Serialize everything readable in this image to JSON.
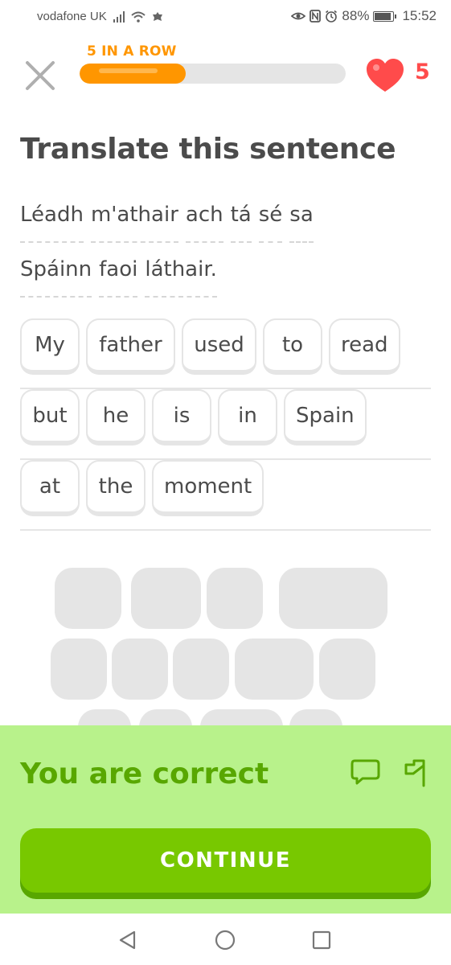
{
  "status_bar": {
    "carrier": "vodafone UK",
    "battery": "88%",
    "time": "15:52",
    "icons": [
      "signal-icon",
      "wifi-icon",
      "notification-icon",
      "eye-comfort-icon",
      "nfc-icon",
      "alarm-icon",
      "battery-icon"
    ]
  },
  "header": {
    "close_icon": "close-icon",
    "streak_label": "5 IN A ROW",
    "progress": 0.4,
    "hearts": "5",
    "colors": {
      "streak": "#ff9600",
      "heart": "#ff4b4b",
      "track": "#e5e5e5"
    }
  },
  "exercise": {
    "title": "Translate this sentence",
    "source_lines": [
      [
        "Léadh",
        "m'athair",
        "ach",
        "tá",
        "sé",
        "sa"
      ],
      [
        "Spáinn",
        "faoi",
        "láthair."
      ]
    ],
    "answer_rows": [
      [
        "My",
        "father",
        "used",
        "to",
        "read"
      ],
      [
        "but",
        "he",
        "is",
        "in",
        "Spain"
      ],
      [
        "at",
        "the",
        "moment"
      ]
    ],
    "word_bank_placeholders": 13
  },
  "feedback": {
    "message": "You are correct",
    "discuss_icon": "comment-icon",
    "report_icon": "flag-icon",
    "continue_label": "CONTINUE",
    "colors": {
      "background": "#b8f28b",
      "text": "#58a700",
      "button": "#78c800"
    }
  },
  "nav_bar": {
    "back": "back-icon",
    "home": "home-icon",
    "recents": "recents-icon"
  }
}
